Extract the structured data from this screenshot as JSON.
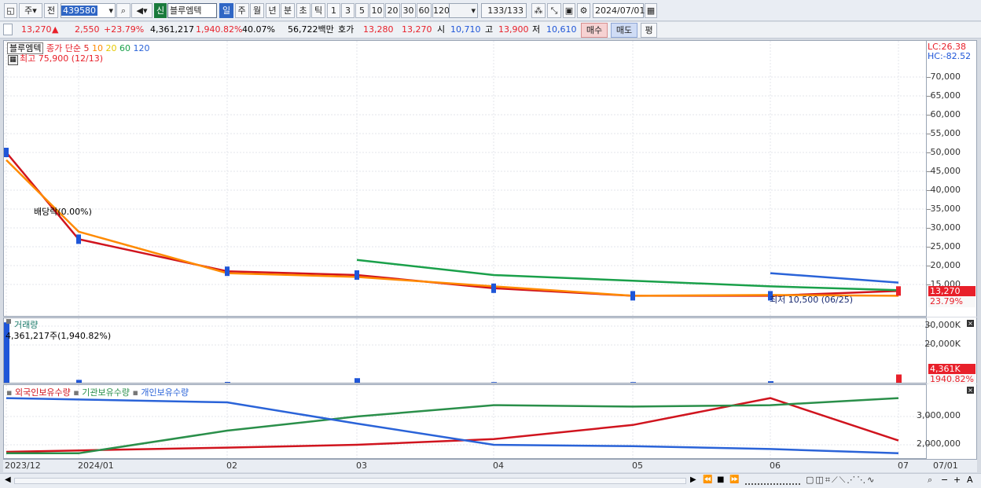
{
  "toolbar": {
    "market_label": "주",
    "prev_label": "전",
    "code": "439580",
    "realtime_badge": "신",
    "name": "블루엠텍",
    "periods": [
      "일",
      "주",
      "월",
      "년",
      "분",
      "초",
      "틱"
    ],
    "intervals": [
      "1",
      "3",
      "5",
      "10",
      "20",
      "30",
      "60",
      "120"
    ],
    "count": "133",
    "count_total": "/133",
    "date": "2024/07/01"
  },
  "quote": {
    "price": "13,270",
    "arrow": "▲",
    "change": "2,550",
    "change_pct": "+23.79%",
    "volume": "4,361,217",
    "volume_pct": "1,940.82%",
    "turnover": "40.07%",
    "amount": "56,722백만",
    "ask_label": "호가",
    "ask": "13,280",
    "bid": "13,270",
    "open_label": "시",
    "open": "10,710",
    "high_label": "고",
    "high": "13,900",
    "low_label": "저",
    "low": "10,610",
    "buy_button": "매수",
    "sell_button": "매도",
    "eval_button": "평"
  },
  "price_panel": {
    "legend_name": "블루엠텍",
    "legend_ma": "종가 단순",
    "ma_periods": [
      "5",
      "10",
      "20",
      "60",
      "120"
    ],
    "ma_colors": [
      "#e02020",
      "#ff8a00",
      "#e6c800",
      "#1aa04a",
      "#2a63d8"
    ],
    "high_note": "최고 75,900 (12/13)",
    "dividend_note": "배당락(0.00%)",
    "low_note": "최저 10,500 (06/25)",
    "lc": "LC:26.38",
    "hc": "HC:-82.52",
    "current_price_box": "13,270",
    "current_pct_box": "23.79%"
  },
  "volume_panel": {
    "title": "거래량",
    "value_note": "4,361,217주(1,940.82%)",
    "current_box": "4,361K",
    "current_pct_box": "1940.82%"
  },
  "holding_panel": {
    "legend": [
      {
        "label": "외국인보유수량",
        "color": "#d0141e"
      },
      {
        "label": "기관보유수량",
        "color": "#2a8f4a"
      },
      {
        "label": "개인보유수량",
        "color": "#2a63d8"
      }
    ]
  },
  "x_labels": [
    "2023/12",
    "2024/01",
    "02",
    "03",
    "04",
    "05",
    "06",
    "07",
    "07/01"
  ],
  "chart_data": [
    {
      "type": "line",
      "title": "블루엠텍 종가 단순 5 10 20 60 120",
      "y_ticks": [
        15000,
        20000,
        25000,
        30000,
        35000,
        40000,
        45000,
        50000,
        55000,
        60000,
        65000,
        70000
      ],
      "y_tick_labels": [
        "15,000",
        "20,000",
        "25,000",
        "30,000",
        "35,000",
        "40,000",
        "45,000",
        "50,000",
        "55,000",
        "60,000",
        "65,000",
        "70,000"
      ],
      "ylim": [
        10000,
        75900
      ],
      "x": [
        "2023/12",
        "2024/01",
        "02",
        "03",
        "04",
        "05",
        "06",
        "07"
      ],
      "series": [
        {
          "name": "종가",
          "values": [
            50000,
            27000,
            18500,
            17500,
            14000,
            12000,
            12000,
            13270
          ]
        },
        {
          "name": "5",
          "values": [
            48000,
            29000,
            18000,
            17000,
            14500,
            12000,
            12200,
            12000
          ]
        },
        {
          "name": "60",
          "values": [
            null,
            null,
            null,
            21500,
            17500,
            16000,
            14500,
            13500
          ]
        },
        {
          "name": "120",
          "values": [
            null,
            null,
            null,
            null,
            null,
            null,
            18000,
            15500
          ]
        }
      ]
    },
    {
      "type": "bar",
      "title": "거래량",
      "y_ticks": [
        20000,
        30000
      ],
      "y_tick_labels": [
        "20,000K",
        "30,000K"
      ],
      "x": [
        "2023/12",
        "2024/01",
        "02",
        "03",
        "04",
        "05",
        "06",
        "07"
      ],
      "values": [
        32000,
        1500,
        400,
        2400,
        300,
        300,
        800,
        4361
      ]
    },
    {
      "type": "line",
      "title": "외국인보유수량 기관보유수량 개인보유수량",
      "y_ticks": [
        2000000,
        3000000
      ],
      "y_tick_labels": [
        "2,000,000",
        "3,000,000"
      ],
      "x": [
        "2023/12",
        "2024/01",
        "02",
        "03",
        "04",
        "05",
        "06",
        "07"
      ],
      "series": [
        {
          "name": "외국인보유수량",
          "values": [
            1750000,
            1800000,
            1900000,
            2000000,
            2200000,
            2700000,
            3650000,
            2150000
          ]
        },
        {
          "name": "기관보유수량",
          "values": [
            1700000,
            1700000,
            2500000,
            3000000,
            3400000,
            3350000,
            3400000,
            3650000
          ]
        },
        {
          "name": "개인보유수량",
          "values": [
            3650000,
            3600000,
            3500000,
            2750000,
            2000000,
            1950000,
            1850000,
            1700000
          ]
        }
      ]
    }
  ]
}
